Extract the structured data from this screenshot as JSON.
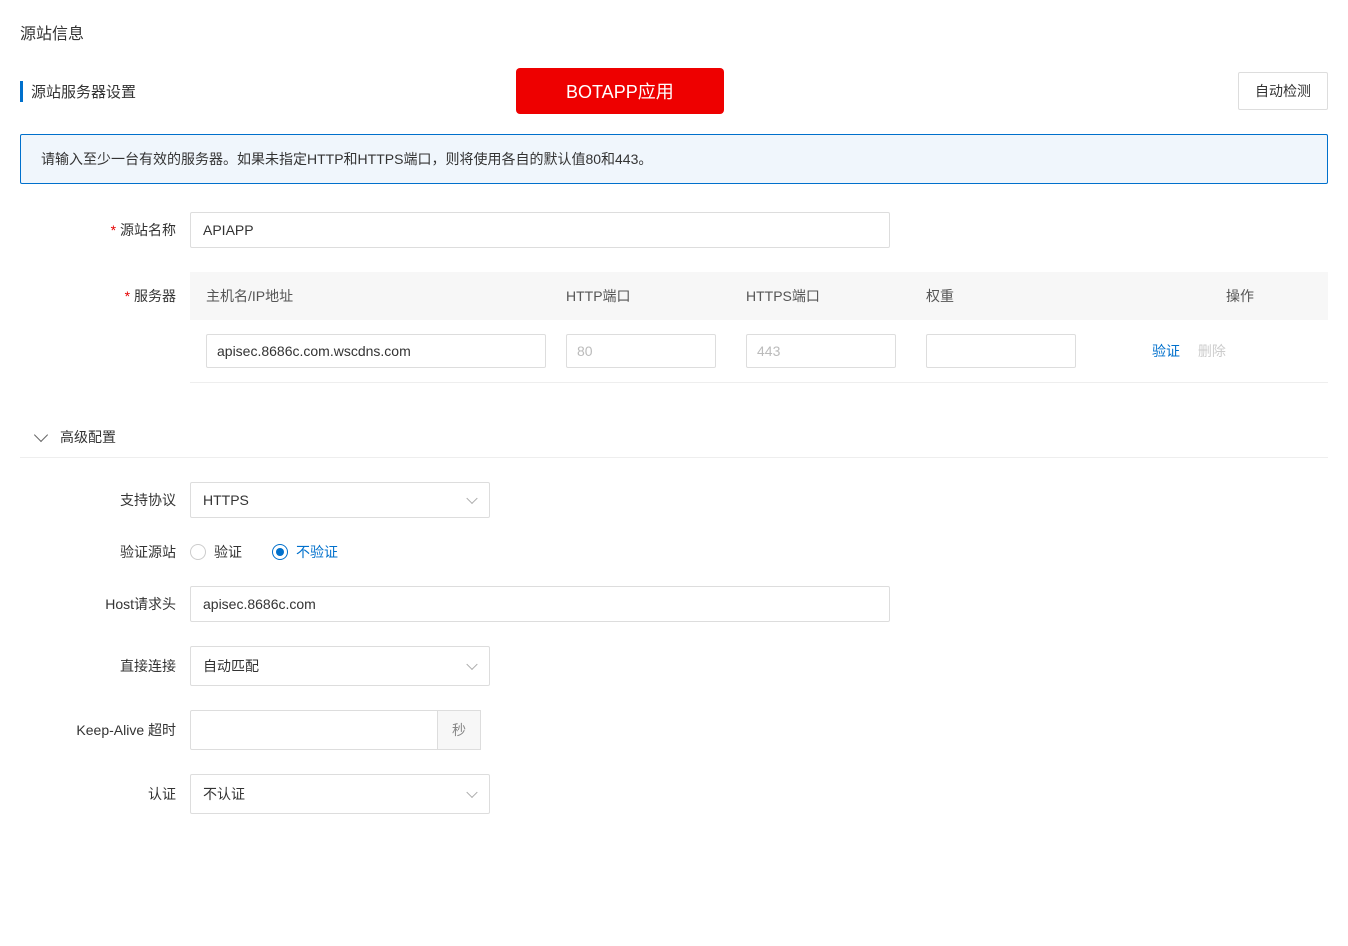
{
  "page_title": "源站信息",
  "section_title": "源站服务器设置",
  "badge_label": "BOTAPP应用",
  "auto_detect_button": "自动检测",
  "info_banner": "请输入至少一台有效的服务器。如果未指定HTTP和HTTPS端口，则将使用各自的默认值80和443。",
  "form": {
    "origin_name_label": "源站名称",
    "origin_name_value": "APIAPP",
    "servers_label": "服务器"
  },
  "table": {
    "headers": {
      "host": "主机名/IP地址",
      "http": "HTTP端口",
      "https": "HTTPS端口",
      "weight": "权重",
      "action": "操作"
    },
    "row": {
      "host_value": "apisec.8686c.com.wscdns.com",
      "http_placeholder": "80",
      "https_placeholder": "443",
      "weight_value": ""
    },
    "verify_label": "验证",
    "delete_label": "删除"
  },
  "advanced": {
    "title": "高级配置",
    "protocol_label": "支持协议",
    "protocol_value": "HTTPS",
    "verify_origin_label": "验证源站",
    "verify_option_yes": "验证",
    "verify_option_no": "不验证",
    "host_header_label": "Host请求头",
    "host_header_value": "apisec.8686c.com",
    "direct_connect_label": "直接连接",
    "direct_connect_value": "自动匹配",
    "keepalive_label": "Keep-Alive 超时",
    "keepalive_unit": "秒",
    "auth_label": "认证",
    "auth_value": "不认证"
  }
}
